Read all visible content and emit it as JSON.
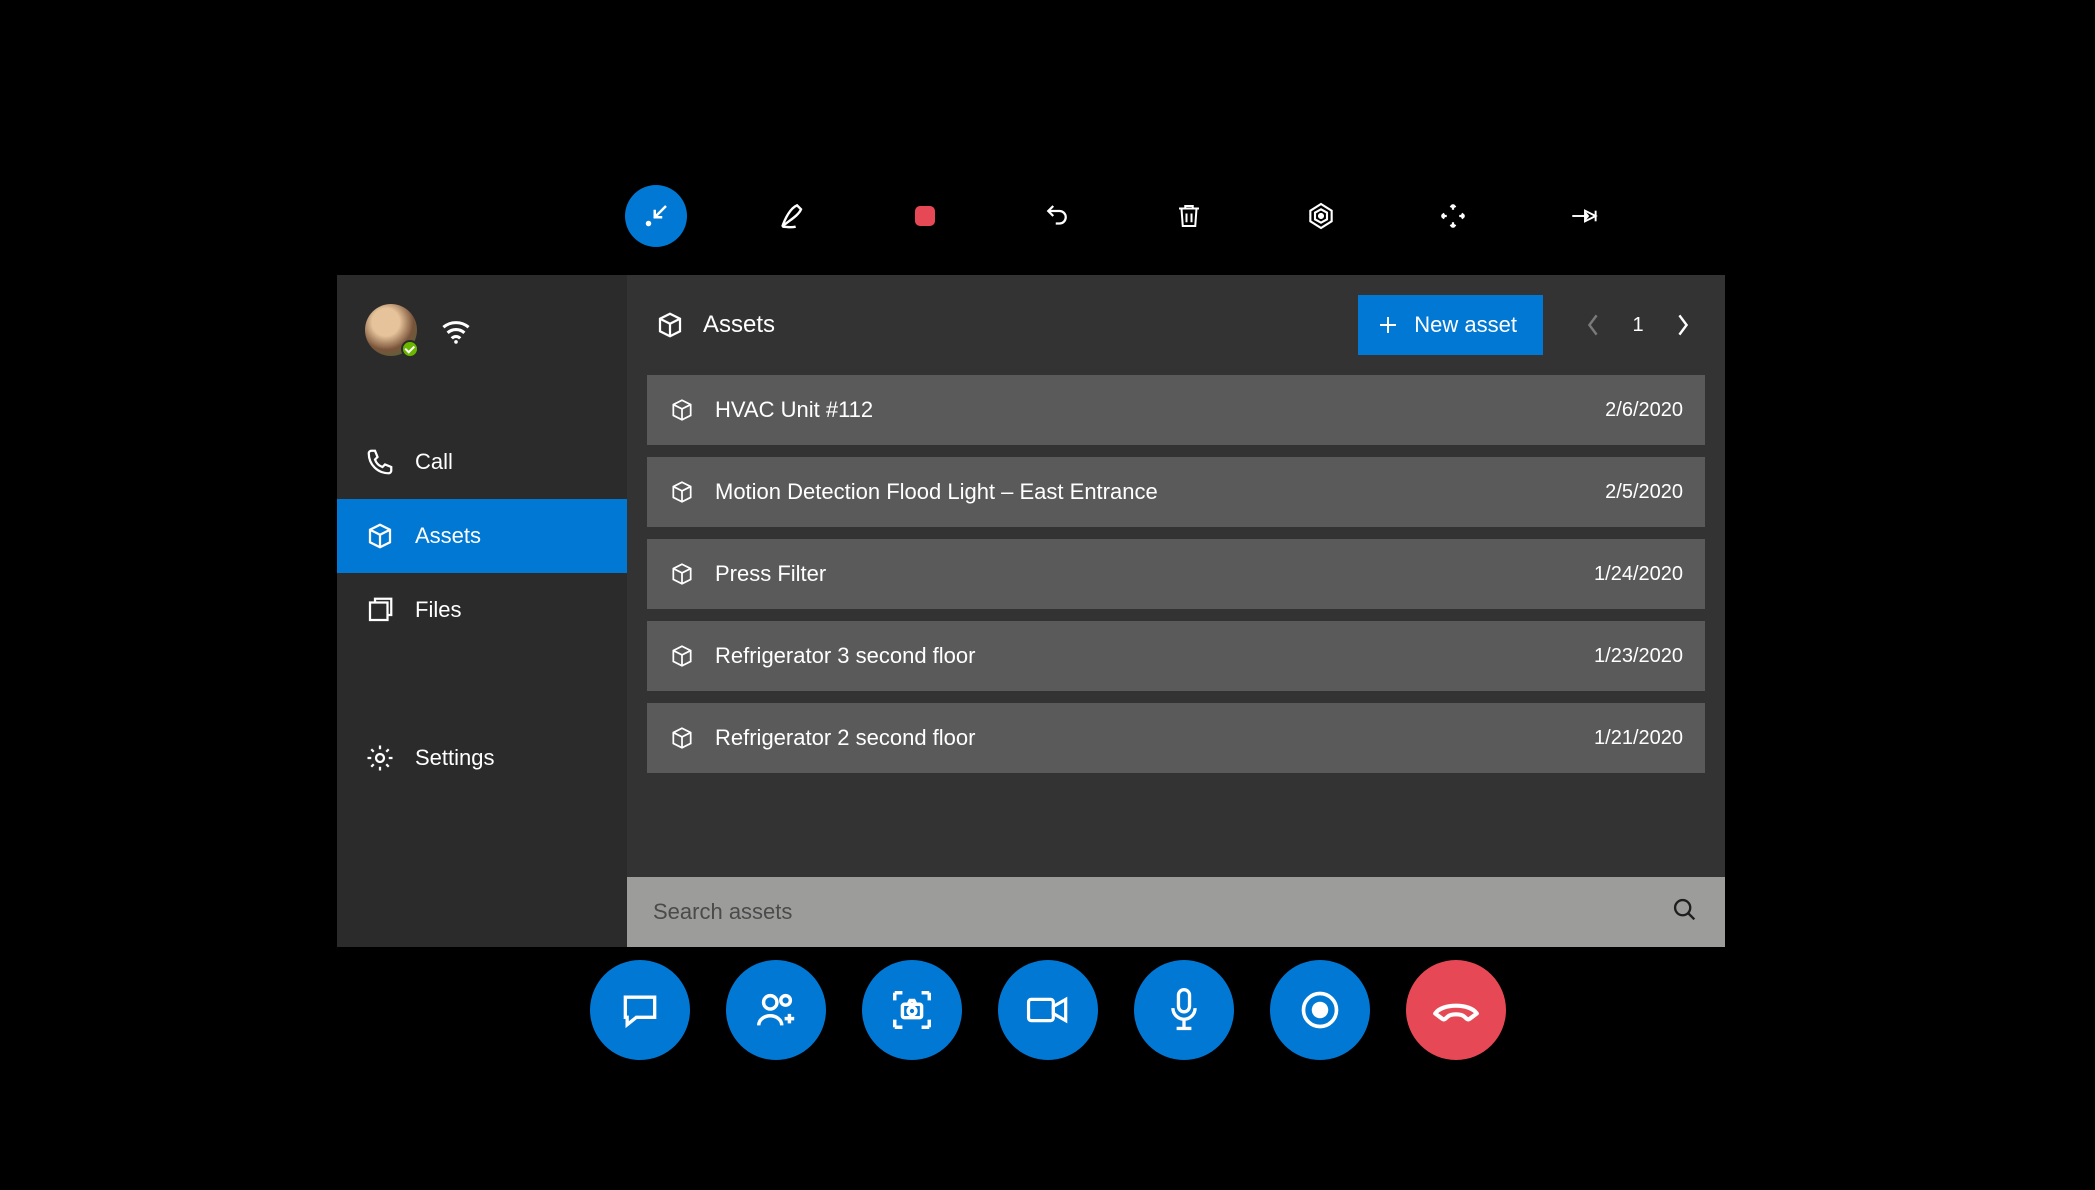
{
  "colors": {
    "accent": "#0078D4",
    "end": "#E74856"
  },
  "sidebar": {
    "items": [
      {
        "key": "call",
        "label": "Call"
      },
      {
        "key": "assets",
        "label": "Assets"
      },
      {
        "key": "files",
        "label": "Files"
      },
      {
        "key": "settings",
        "label": "Settings"
      }
    ],
    "active": "assets"
  },
  "header": {
    "title": "Assets",
    "new_button": "New asset",
    "page": "1"
  },
  "assets": [
    {
      "name": "HVAC Unit #112",
      "date": "2/6/2020"
    },
    {
      "name": "Motion Detection Flood Light – East Entrance",
      "date": "2/5/2020"
    },
    {
      "name": "Press Filter",
      "date": "1/24/2020"
    },
    {
      "name": "Refrigerator 3 second floor",
      "date": "1/23/2020"
    },
    {
      "name": "Refrigerator 2 second floor",
      "date": "1/21/2020"
    }
  ],
  "search": {
    "placeholder": "Search assets"
  },
  "top_tools": [
    {
      "key": "minimize",
      "icon": "arrow-in"
    },
    {
      "key": "ink",
      "icon": "pen"
    },
    {
      "key": "stop",
      "icon": "stop"
    },
    {
      "key": "undo",
      "icon": "undo"
    },
    {
      "key": "delete",
      "icon": "trash"
    },
    {
      "key": "target",
      "icon": "target"
    },
    {
      "key": "move",
      "icon": "move"
    },
    {
      "key": "pin",
      "icon": "pin"
    }
  ],
  "call_bar": [
    {
      "key": "chat",
      "icon": "chat"
    },
    {
      "key": "people",
      "icon": "people"
    },
    {
      "key": "snapshot",
      "icon": "snapshot"
    },
    {
      "key": "video",
      "icon": "video"
    },
    {
      "key": "mic",
      "icon": "mic"
    },
    {
      "key": "record",
      "icon": "record"
    },
    {
      "key": "hangup",
      "icon": "hangup"
    }
  ]
}
